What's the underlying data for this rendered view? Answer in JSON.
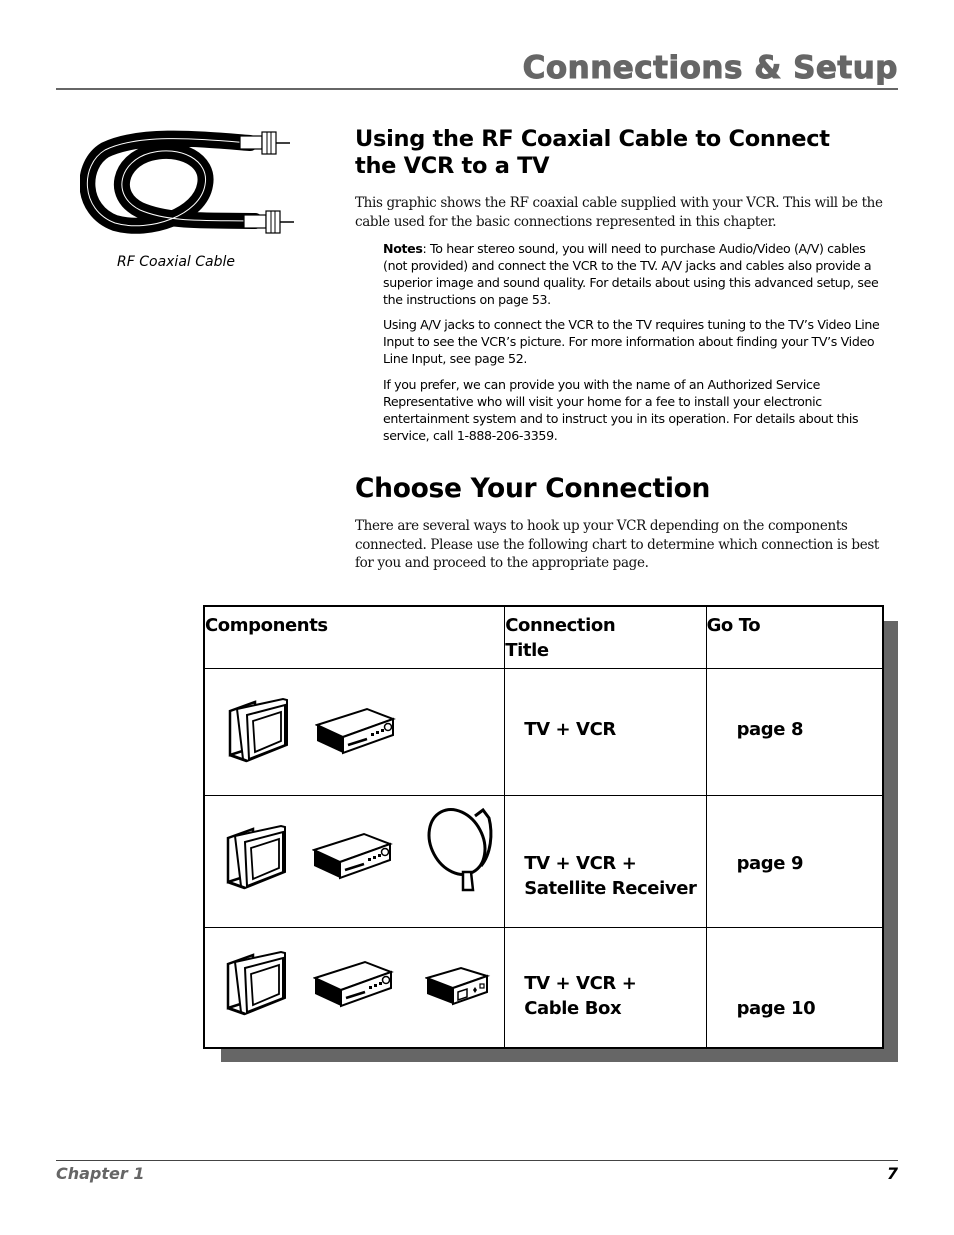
{
  "header": {
    "title": "Connections & Setup",
    "accent_color": "#666666"
  },
  "cable_figure": {
    "icon": "coaxial-cable-icon",
    "caption": "RF Coaxial Cable"
  },
  "section_rf": {
    "heading": "Using the RF Coaxial Cable to Connect the VCR to a TV",
    "intro": "This graphic shows the RF coaxial cable supplied with your VCR. This will be the cable used for the basic connections represented in this chapter.",
    "notes": [
      {
        "label": "Notes",
        "text": ": To hear stereo sound, you will need to purchase Audio/Video (A/V) cables (not provided) and connect the VCR to the TV. A/V jacks and cables also provide a superior image and sound quality. For details about using this advanced setup, see the instructions on page 53."
      },
      {
        "text": "Using A/V jacks to connect the VCR to the TV requires tuning to the TV’s Video Line Input to see the VCR’s picture. For more information about finding your TV’s Video Line Input, see page 52."
      },
      {
        "text": "If you prefer, we can provide you with the name of an Authorized Service Representative who will visit your home for a fee to install your electronic entertainment system and to instruct you in its operation. For details about this service, call 1-888-206-3359."
      }
    ]
  },
  "section_choose": {
    "heading": "Choose Your Connection",
    "intro": "There are several ways to hook up your VCR depending on the components connected. Please use the following chart to determine which connection is best for you and proceed to the appropriate page."
  },
  "connection_table": {
    "headers": [
      "Components",
      "Connection Title",
      "Go To"
    ],
    "header_title_lines": [
      "Connection",
      "Title"
    ],
    "rows": [
      {
        "components": [
          "tv-icon",
          "vcr-icon"
        ],
        "title_lines": [
          "TV + VCR"
        ],
        "goto": "page 8"
      },
      {
        "components": [
          "tv-icon",
          "vcr-icon",
          "satellite-dish-icon"
        ],
        "title_lines": [
          "TV + VCR +",
          "Satellite Receiver"
        ],
        "goto": "page 9"
      },
      {
        "components": [
          "tv-icon",
          "vcr-icon",
          "cable-box-icon"
        ],
        "title_lines": [
          "TV + VCR +",
          "Cable Box"
        ],
        "goto": "page 10"
      }
    ],
    "shadow_color": "#666666"
  },
  "footer": {
    "chapter": "Chapter 1",
    "page_number": "7"
  }
}
